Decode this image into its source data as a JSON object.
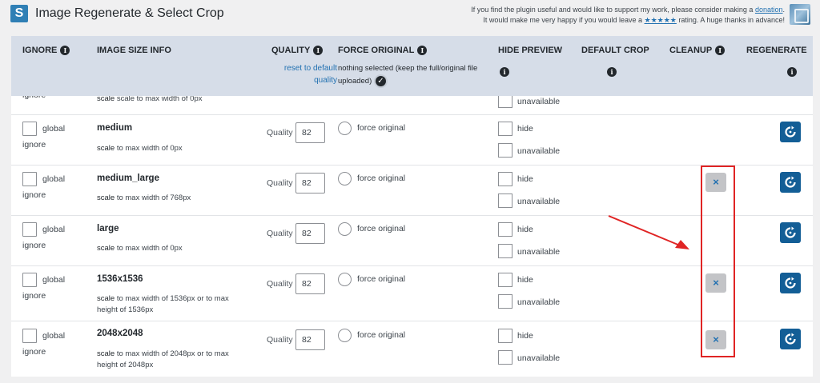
{
  "app": {
    "title": "Image Regenerate & Select Crop",
    "support_line1": "If you find the plugin useful and would like to support my work, please consider making a",
    "support_link": "donation",
    "support_line1_end": ".",
    "support_line2_start": "It would make me very happy if you would leave a",
    "support_stars": "★★★★★",
    "support_line2_end": "rating. A huge thanks in advance!"
  },
  "header": {
    "ignore": "IGNORE",
    "image_size_info": "IMAGE SIZE INFO",
    "quality": "QUALITY",
    "reset_line1": "reset to default",
    "reset_line2": "quality",
    "force_original": "FORCE ORIGINAL",
    "force_note": "nothing selected (keep the full/original file uploaded)",
    "hide_preview": "HIDE PREVIEW",
    "default_crop": "DEFAULT CROP",
    "cleanup": "CLEANUP",
    "regenerate": "REGENERATE"
  },
  "partial_row": {
    "info": "scale to max width of 0px",
    "ignore_text": "ignore",
    "hp_label": "unavailable"
  },
  "labels": {
    "global": "global",
    "ignore": "ignore",
    "quality": "Quality",
    "force_original": "force original",
    "hide": "hide",
    "unavailable": "unavailable"
  },
  "rows": [
    {
      "name": "medium",
      "info_prefix": "scale",
      "info": "to max width of 0px",
      "quality": "82",
      "cleanup": false
    },
    {
      "name": "medium_large",
      "info_prefix": "scale",
      "info": "to max width of 768px",
      "quality": "82",
      "cleanup": true
    },
    {
      "name": "large",
      "info_prefix": "scale",
      "info": "to max width of 0px",
      "quality": "82",
      "cleanup": false
    },
    {
      "name": "1536x1536",
      "info_prefix": "scale",
      "info": "to max width of 1536px or to max height of 1536px",
      "quality": "82",
      "cleanup": true
    },
    {
      "name": "2048x2048",
      "info_prefix": "scale",
      "info": "to max width of 2048px or to max height of 2048px",
      "quality": "82",
      "cleanup": true
    }
  ],
  "icons": {
    "info": "info-icon",
    "check": "check-circle-icon",
    "cleanup": "close-icon",
    "regenerate": "refresh-icon"
  },
  "colors": {
    "header_bg": "#d6dde8",
    "link": "#2271b1",
    "regen_button": "#135e96",
    "highlight": "#e02424"
  }
}
